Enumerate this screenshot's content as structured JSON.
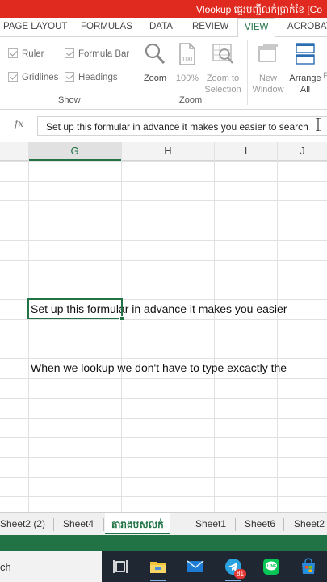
{
  "window": {
    "title": "Vlookup ផ្ទេរបញ្ជីលក់ប្រាក់ខែ [Co"
  },
  "ribbon_tabs": [
    {
      "label": "PAGE LAYOUT"
    },
    {
      "label": "FORMULAS"
    },
    {
      "label": "DATA"
    },
    {
      "label": "REVIEW"
    },
    {
      "label": "VIEW",
      "active": true
    },
    {
      "label": "ACROBAT"
    }
  ],
  "show_group": {
    "label": "Show",
    "ruler": "Ruler",
    "formula_bar": "Formula Bar",
    "gridlines": "Gridlines",
    "headings": "Headings"
  },
  "zoom_group": {
    "label": "Zoom",
    "zoom": "Zoom",
    "zoom100": "100%",
    "zoom_to_selection_1": "Zoom to",
    "zoom_to_selection_2": "Selection"
  },
  "window_group": {
    "new_window_1": "New",
    "new_window_2": "Window",
    "arrange_all_1": "Arrange",
    "arrange_all_2": "All"
  },
  "formula_bar": {
    "fx": "fx",
    "content": "Set up this formular in advance it makes you easier to search"
  },
  "columns": [
    "G",
    "H",
    "I",
    "J"
  ],
  "selected_column": "G",
  "cells": {
    "row_a": "Set up this formular in advance it makes you easier",
    "row_b": "When we lookup we don't have to type excactly the"
  },
  "sheet_tabs": [
    {
      "label": "Sheet2 (2)"
    },
    {
      "label": "Sheet4"
    },
    {
      "label": "តារាងបសលក់",
      "active": true
    },
    {
      "label": "Sheet1"
    },
    {
      "label": "Sheet6"
    },
    {
      "label": "Sheet2"
    }
  ],
  "taskbar": {
    "search_text": "ch",
    "telegram_badge": "81"
  },
  "colors": {
    "excel_green": "#217346",
    "title_red": "#e02a1f",
    "taskbar": "#1f2733"
  }
}
